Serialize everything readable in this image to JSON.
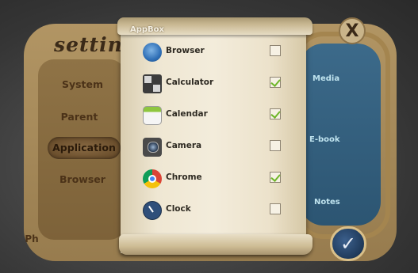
{
  "settings": {
    "title": "setting",
    "menu": [
      {
        "label": "System",
        "active": false
      },
      {
        "label": "Parent",
        "active": false
      },
      {
        "label": "Application",
        "active": true
      },
      {
        "label": "Browser",
        "active": false
      }
    ],
    "bottom_left_partial": "Ph"
  },
  "right_panel": {
    "labels": [
      "Media",
      "E-book",
      "Notes"
    ]
  },
  "appbox": {
    "title": "AppBox",
    "apps": [
      {
        "name": "Browser",
        "icon": "browser-icon",
        "checked": false
      },
      {
        "name": "Calculator",
        "icon": "calculator-icon",
        "checked": true
      },
      {
        "name": "Calendar",
        "icon": "calendar-icon",
        "checked": true
      },
      {
        "name": "Camera",
        "icon": "camera-icon",
        "checked": false
      },
      {
        "name": "Chrome",
        "icon": "chrome-icon",
        "checked": true
      },
      {
        "name": "Clock",
        "icon": "clock-icon",
        "checked": false
      }
    ]
  },
  "buttons": {
    "close": "X",
    "confirm": "✓"
  },
  "colors": {
    "check_accent": "#6fb62a",
    "scroll_paper": "#efe7d3",
    "frame_wood": "#9c7f4f"
  }
}
